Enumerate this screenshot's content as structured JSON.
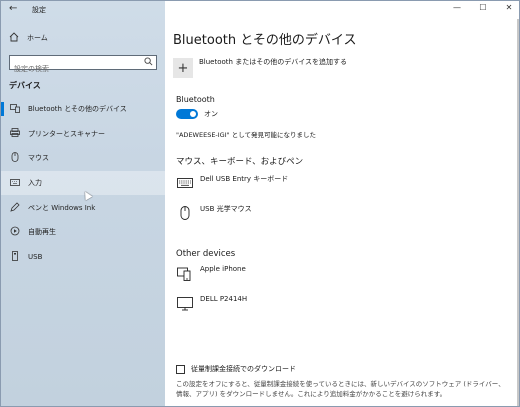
{
  "window": {
    "title": "設定",
    "controls": [
      "—",
      "☐",
      "✕"
    ]
  },
  "sidebar": {
    "home_label": "ホーム",
    "search_placeholder": "設定の検索",
    "section_title": "デバイス",
    "items": [
      {
        "label": "Bluetooth とその他のデバイス",
        "icon": "bluetooth-devices-icon",
        "active": true
      },
      {
        "label": "プリンターとスキャナー",
        "icon": "printer-icon"
      },
      {
        "label": "マウス",
        "icon": "mouse-icon"
      },
      {
        "label": "入力",
        "icon": "keyboard-icon",
        "hover": true
      },
      {
        "label": "ペンと Windows Ink",
        "icon": "pen-icon"
      },
      {
        "label": "自動再生",
        "icon": "autoplay-icon"
      },
      {
        "label": "USB",
        "icon": "usb-icon"
      }
    ]
  },
  "main": {
    "title": "Bluetooth とその他のデバイス",
    "add_device_label": "Bluetooth またはその他のデバイスを追加する",
    "bluetooth_label": "Bluetooth",
    "toggle_label": "オン",
    "toggle_on": true,
    "discoverable_text": "\"ADEWEESE-IGI\" として発見可能になりました",
    "input_section_title": "マウス、キーボード、およびペン",
    "input_devices": [
      {
        "name": "Dell USB Entry キーボード",
        "icon": "keyboard-icon"
      },
      {
        "name": "USB 光学マウス",
        "icon": "mouse-icon"
      }
    ],
    "other_section_title": "Other devices",
    "other_devices": [
      {
        "name": "Apple iPhone",
        "icon": "phone-icon"
      },
      {
        "name": "DELL P2414H",
        "icon": "monitor-icon"
      }
    ],
    "metered_label": "従量制課金接続でのダウンロード",
    "metered_checked": false,
    "metered_description": "この設定をオフにすると、従量制課金接続を使っているときには、新しいデバイスのソフトウェア (ドライバー、情報、アプリ) をダウンロードしません。これにより追加料金がかかることを避けられます。"
  },
  "colors": {
    "accent": "#0078d7",
    "sidebar_bg": "#c8d6e3"
  }
}
